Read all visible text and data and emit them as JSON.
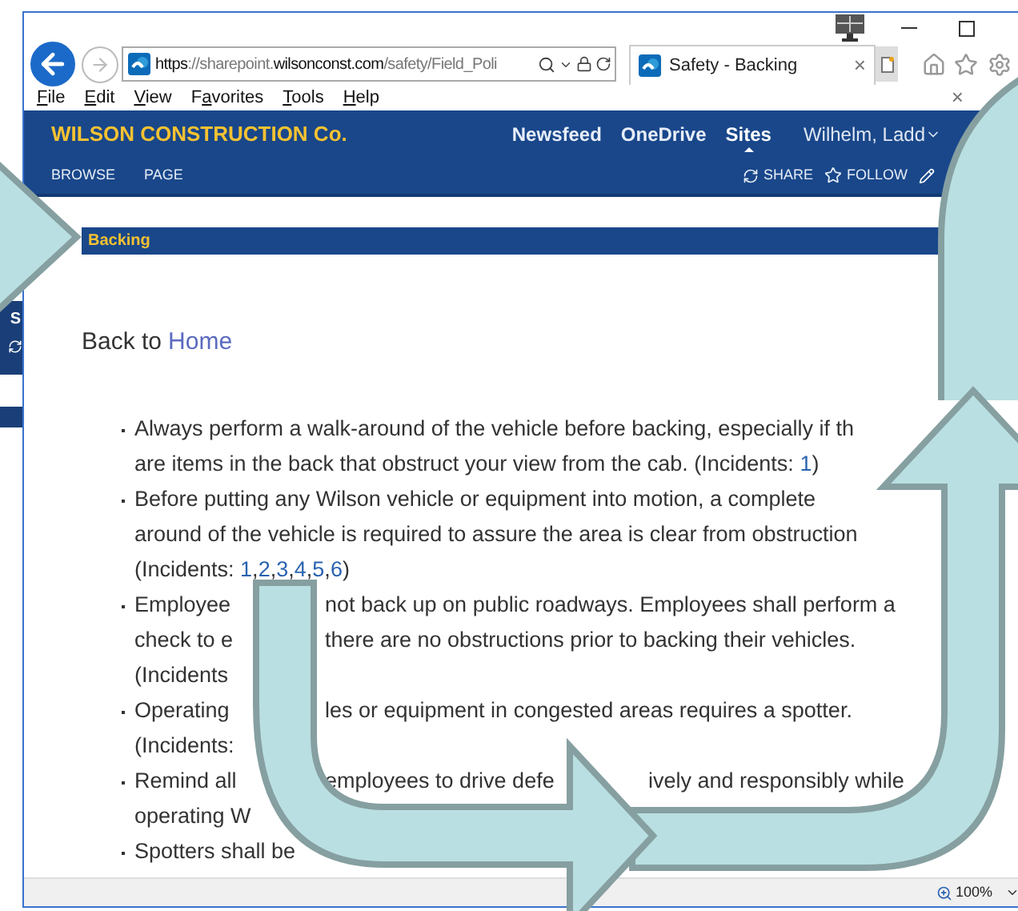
{
  "browser": {
    "address_parts": [
      {
        "text": "https",
        "dim": false
      },
      {
        "text": "://sharepoint.",
        "dim": true
      },
      {
        "text": "wilsonconst.com",
        "dim": false
      },
      {
        "text": "/safety/Field_Poli",
        "dim": true
      }
    ],
    "tab_title": "Safety - Backing",
    "tab_close": "×",
    "menu": [
      {
        "key": "F",
        "post": "ile"
      },
      {
        "key": "E",
        "post": "dit"
      },
      {
        "key": "V",
        "post": "iew"
      },
      {
        "pre": "F",
        "key": "a",
        "post": "vorites"
      },
      {
        "key": "T",
        "post": "ools"
      },
      {
        "key": "H",
        "post": "elp"
      }
    ],
    "menu_close": "×"
  },
  "side_panel": {
    "letter": "S"
  },
  "site": {
    "title": "WILSON CONSTRUCTION Co.",
    "nav": [
      {
        "label": "Newsfeed",
        "selected": false
      },
      {
        "label": "OneDrive",
        "selected": false
      },
      {
        "label": "Sites",
        "selected": true
      }
    ],
    "user": "Wilhelm, Ladd",
    "ribbon_tabs": [
      "BROWSE",
      "PAGE"
    ],
    "actions": [
      "SHARE",
      "FOLLOW"
    ]
  },
  "page": {
    "heading": "Backing",
    "back_prefix": "Back to",
    "back_link": "Home",
    "items": [
      {
        "lines": [
          {
            "fragments": [
              [
                {
                  "kind": "text",
                  "text": "Always perform a walk-around of the vehicle before backing, especially if th"
                }
              ]
            ]
          },
          {
            "fragments": [
              [
                {
                  "kind": "text",
                  "text": "are items in the back that obstruct your view from the cab. (Incidents: "
                },
                {
                  "kind": "link",
                  "text": "1"
                },
                {
                  "kind": "text",
                  "text": ")"
                }
              ]
            ]
          }
        ]
      },
      {
        "lines": [
          {
            "fragments": [
              [
                {
                  "kind": "text",
                  "text": "Before putting any Wilson vehicle or equipment into motion, a complete"
                }
              ]
            ]
          },
          {
            "fragments": [
              [
                {
                  "kind": "text",
                  "text": "around of the vehicle is required to assure the area is clear from obstruction"
                }
              ]
            ]
          },
          {
            "fragments": [
              [
                {
                  "kind": "text",
                  "text": "(Incidents: "
                },
                {
                  "kind": "link",
                  "text": "1"
                },
                {
                  "kind": "text",
                  "text": ","
                },
                {
                  "kind": "link",
                  "text": "2"
                },
                {
                  "kind": "text",
                  "text": ","
                },
                {
                  "kind": "link",
                  "text": "3"
                },
                {
                  "kind": "text",
                  "text": ","
                },
                {
                  "kind": "link",
                  "text": "4"
                },
                {
                  "kind": "text",
                  "text": ","
                },
                {
                  "kind": "link",
                  "text": "5"
                },
                {
                  "kind": "text",
                  "text": ","
                },
                {
                  "kind": "link",
                  "text": "6"
                },
                {
                  "kind": "text",
                  "text": ")"
                }
              ]
            ]
          }
        ]
      },
      {
        "lines": [
          {
            "fragments": [
              [
                {
                  "kind": "text",
                  "text": "Employee"
                }
              ],
              [
                {
                  "kind": "text",
                  "text": "not back up on public roadways. Employees shall perform a"
                }
              ]
            ]
          },
          {
            "fragments": [
              [
                {
                  "kind": "text",
                  "text": "check to e"
                }
              ],
              [
                {
                  "kind": "text",
                  "text": "there are no obstructions prior to backing their vehicles."
                }
              ]
            ]
          },
          {
            "fragments": [
              [
                {
                  "kind": "text",
                  "text": "(Incidents"
                }
              ]
            ]
          }
        ]
      },
      {
        "lines": [
          {
            "fragments": [
              [
                {
                  "kind": "text",
                  "text": "Operating"
                }
              ],
              [
                {
                  "kind": "text",
                  "text": "les or equipment in congested areas requires a spotter."
                }
              ]
            ]
          },
          {
            "fragments": [
              [
                {
                  "kind": "text",
                  "text": "(Incidents:"
                }
              ]
            ]
          }
        ]
      },
      {
        "lines": [
          {
            "fragments": [
              [
                {
                  "kind": "text",
                  "text": "Remind all"
                }
              ],
              [
                {
                  "kind": "text",
                  "text": "employees to drive defe"
                }
              ],
              [
                {
                  "kind": "text",
                  "text": "ively and responsibly while"
                }
              ]
            ]
          },
          {
            "fragments": [
              [
                {
                  "kind": "text",
                  "text": "operating W"
                }
              ]
            ]
          }
        ]
      },
      {
        "lines": [
          {
            "fragments": [
              [
                {
                  "kind": "text",
                  "text": "Spotters shall be"
                }
              ]
            ]
          }
        ]
      }
    ]
  },
  "status_bar": {
    "zoom": "100%"
  }
}
